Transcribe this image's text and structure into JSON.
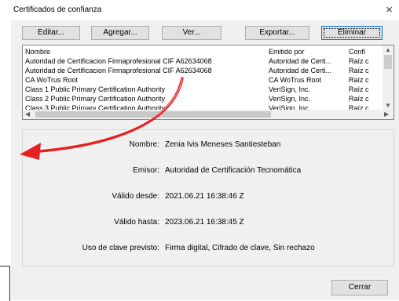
{
  "window": {
    "title": "Certificados de confianza",
    "close": "×"
  },
  "toolbar": {
    "edit": "Editar...",
    "add": "Agregar...",
    "view": "Ver...",
    "export": "Exportar...",
    "delete": "Eliminar"
  },
  "list": {
    "headers": [
      "Nombre",
      "Emitido por",
      "Confi"
    ],
    "rows": [
      [
        "Autoridad de Certificacion Firmaprofesional CIF A62634068",
        "Autoridad de Certi...",
        "Raíz c"
      ],
      [
        "Autoridad de Certificacion Firmaprofesional CIF A62634068",
        "Autoridad de Certi...",
        "Raíz c"
      ],
      [
        "CA WoTrus Root",
        "CA WoTrus Root",
        "Raíz c"
      ],
      [
        "Class 1 Public Primary Certification Authority",
        "VeriSign, Inc.",
        "Raíz c"
      ],
      [
        "Class 2 Public Primary Certification Authority",
        "VeriSign, Inc.",
        "Raíz c"
      ],
      [
        "Class 3 Public Primary Certification Authority",
        "VeriSign, Inc.",
        "Raíz c"
      ]
    ]
  },
  "details": {
    "name_label": "Nombre:",
    "name_value": "Zenia Ivis Meneses Santiesteban",
    "issuer_label": "Emisor:",
    "issuer_value": "Autoridad de Certificación Tecnomática",
    "from_label": "Válido desde:",
    "from_value": "2021.06.21 16:38:46 Z",
    "to_label": "Válido hasta:",
    "to_value": "2023.06.21 16:38:45 Z",
    "usage_label": "Uso de clave previsto:",
    "usage_value": "Firma digital, Cifrado de clave, Sin rechazo"
  },
  "footer": {
    "close": "Cerrar"
  },
  "colors": {
    "arrow": "#e52222",
    "accent": "#0078d7"
  }
}
